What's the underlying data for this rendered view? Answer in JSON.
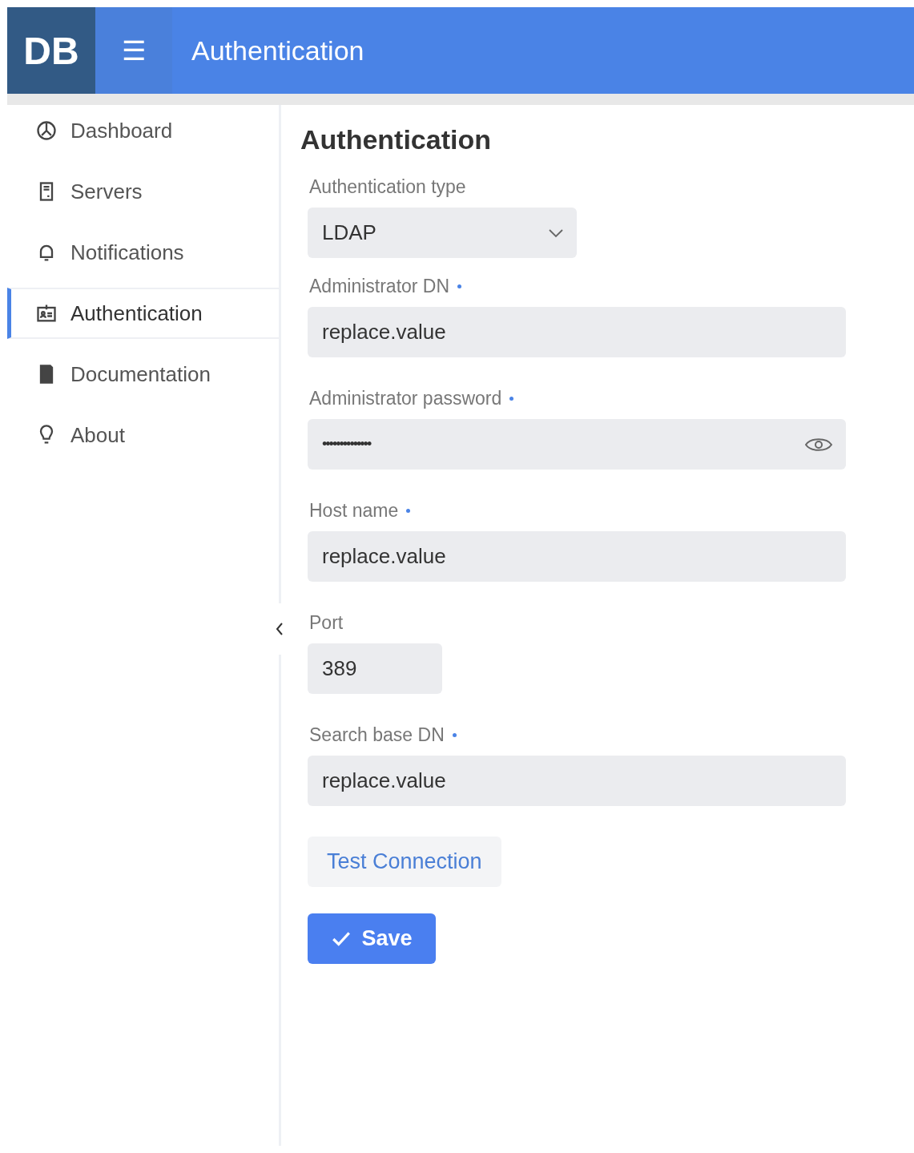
{
  "header": {
    "logo": "DB",
    "menu_icon": "☰",
    "title": "Authentication"
  },
  "sidebar": {
    "items": [
      {
        "label": "Dashboard",
        "selected": false
      },
      {
        "label": "Servers",
        "selected": false
      },
      {
        "label": "Notifications",
        "selected": false
      },
      {
        "label": "Authentication",
        "selected": true
      },
      {
        "label": "Documentation",
        "selected": false
      },
      {
        "label": "About",
        "selected": false
      }
    ]
  },
  "main": {
    "title": "Authentication",
    "fields": [
      {
        "kind": "select",
        "label": "Authentication type",
        "required": false,
        "value": "LDAP"
      },
      {
        "kind": "text",
        "label": "Administrator DN",
        "required": true,
        "value": "replace.value"
      },
      {
        "kind": "password",
        "label": "Administrator password",
        "required": true,
        "value": "••••••••••••••"
      },
      {
        "kind": "text",
        "label": "Host name",
        "required": true,
        "value": "replace.value"
      },
      {
        "kind": "number",
        "label": "Port",
        "required": false,
        "value": "389"
      },
      {
        "kind": "text",
        "label": "Search base DN",
        "required": true,
        "value": "replace.value"
      }
    ],
    "test_button": "Test Connection",
    "save_button": "Save"
  }
}
